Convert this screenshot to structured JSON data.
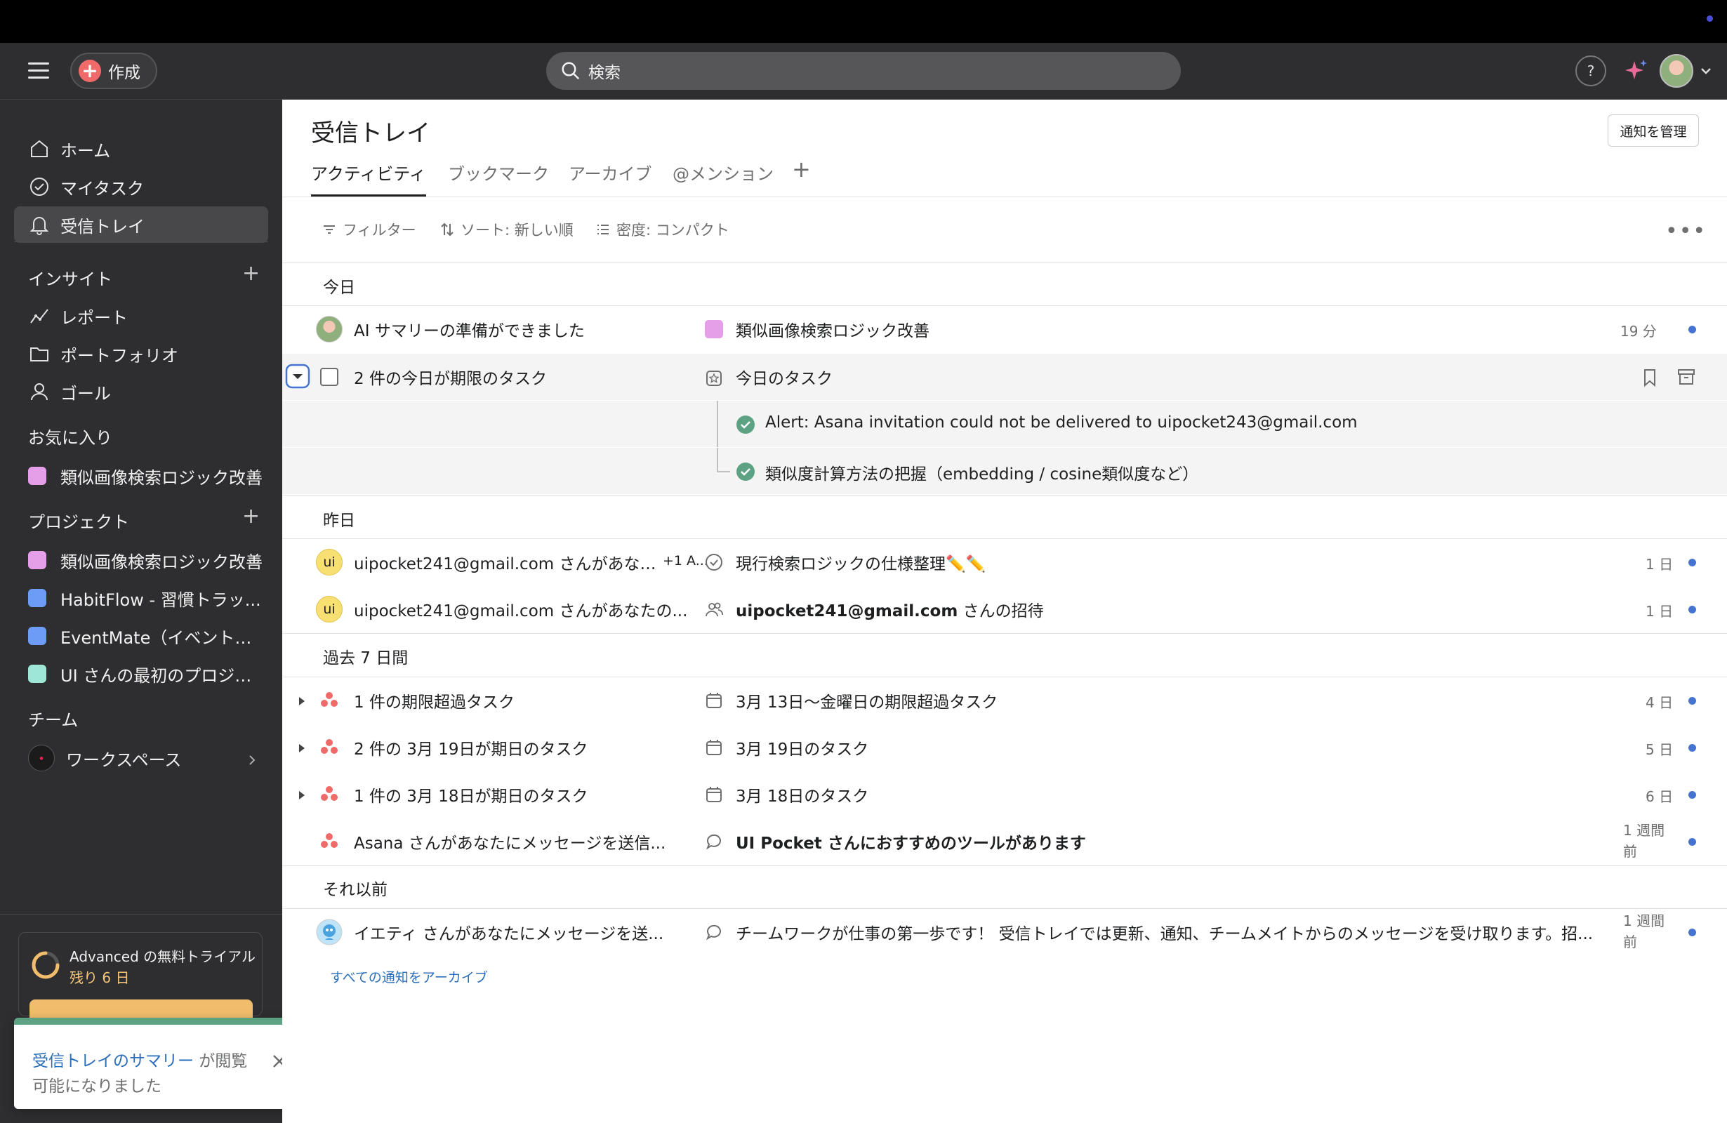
{
  "topbar": {
    "create_label": "作成",
    "search_placeholder": "検索"
  },
  "sidebar": {
    "nav": [
      {
        "label": "ホーム",
        "icon": "home-icon"
      },
      {
        "label": "マイタスク",
        "icon": "check-circle-icon"
      },
      {
        "label": "受信トレイ",
        "icon": "bell-icon",
        "active": true
      }
    ],
    "insights_heading": "インサイト",
    "insights": [
      {
        "label": "レポート",
        "icon": "chart-line-icon"
      },
      {
        "label": "ポートフォリオ",
        "icon": "folder-icon"
      },
      {
        "label": "ゴール",
        "icon": "person-icon"
      }
    ],
    "favorites_heading": "お気に入り",
    "favorites": [
      {
        "label": "類似画像検索ロジック改善",
        "color": "#e59fe8"
      }
    ],
    "projects_heading": "プロジェクト",
    "projects": [
      {
        "label": "類似画像検索ロジック改善",
        "color": "#e59fe8"
      },
      {
        "label": "HabitFlow - 習慣トラッ...",
        "color": "#6d9cf7"
      },
      {
        "label": "EventMate（イベント管...",
        "color": "#6d9cf7"
      },
      {
        "label": "UI さんの最初のプロジェ...",
        "color": "#9ee7d6"
      }
    ],
    "team_heading": "チーム",
    "workspace_label": "ワークスペース",
    "trial_title": "Advanced の無料トライアル",
    "trial_sub": "残り 6 日"
  },
  "toast": {
    "link": "受信トレイのサマリー",
    "text1": " が閲覧",
    "text2": "可能になりました"
  },
  "main": {
    "title": "受信トレイ",
    "manage_label": "通知を管理",
    "tabs": [
      "アクティビティ",
      "ブックマーク",
      "アーカイブ",
      "@メンション"
    ],
    "filter_label": "フィルター",
    "sort_label": "ソート: 新しい順",
    "density_label": "密度: コンパクト",
    "sections": {
      "today": "今日",
      "yesterday": "昨日",
      "past7": "過去 7 日間",
      "earlier": "それ以前"
    },
    "rows": {
      "r1": {
        "title": "AI サマリーの準備ができました",
        "project": "類似画像検索ロジック改善",
        "time": "19 分",
        "swatch": "#e59fe8"
      },
      "r2": {
        "title": "2 件の今日が期限のタスク",
        "project": "今日のタスク"
      },
      "r2a": {
        "text": "Alert: Asana invitation could not be delivered to uipocket243@gmail.com"
      },
      "r2b": {
        "text": "類似度計算方法の把握（embedding / cosine類似度など）"
      },
      "r3": {
        "avatar": "ui",
        "title": "uipocket241@gmail.com さんがあなた...",
        "extra": "+1 A...",
        "project": "現行検索ロジックの仕様整理✏️✏️",
        "time": "1 日"
      },
      "r4": {
        "avatar": "ui",
        "title": "uipocket241@gmail.com さんがあなたの...",
        "project_bold": "uipocket241@gmail.com",
        "project_rest": " さんの招待",
        "time": "1 日"
      },
      "r5": {
        "title": "1 件の期限超過タスク",
        "project": "3月 13日〜金曜日の期限超過タスク",
        "time": "4 日"
      },
      "r6": {
        "title": "2 件の 3月 19日が期日のタスク",
        "project": "3月 19日のタスク",
        "time": "5 日"
      },
      "r7": {
        "title": "1 件の 3月 18日が期日のタスク",
        "project": "3月 18日のタスク",
        "time": "6 日"
      },
      "r8": {
        "title": "Asana さんがあなたにメッセージを送信...",
        "project": "UI Pocket さんにおすすめのツールがあります",
        "time1": "1 週間",
        "time2": "前"
      },
      "r9": {
        "title": "イエティ さんがあなたにメッセージを送...",
        "project": "チームワークが仕事の第一歩です！ 受信トレイでは更新、通知、チームメイトからのメッセージを受け取ります。招...",
        "time1": "1 週間",
        "time2": "前"
      }
    },
    "archive_all": "すべての通知をアーカイブ"
  },
  "colors": {
    "unread_dot": "#4573d2",
    "sidebar_bg": "#2e2e30",
    "success": "#5da283",
    "link": "#2a6ebb"
  }
}
